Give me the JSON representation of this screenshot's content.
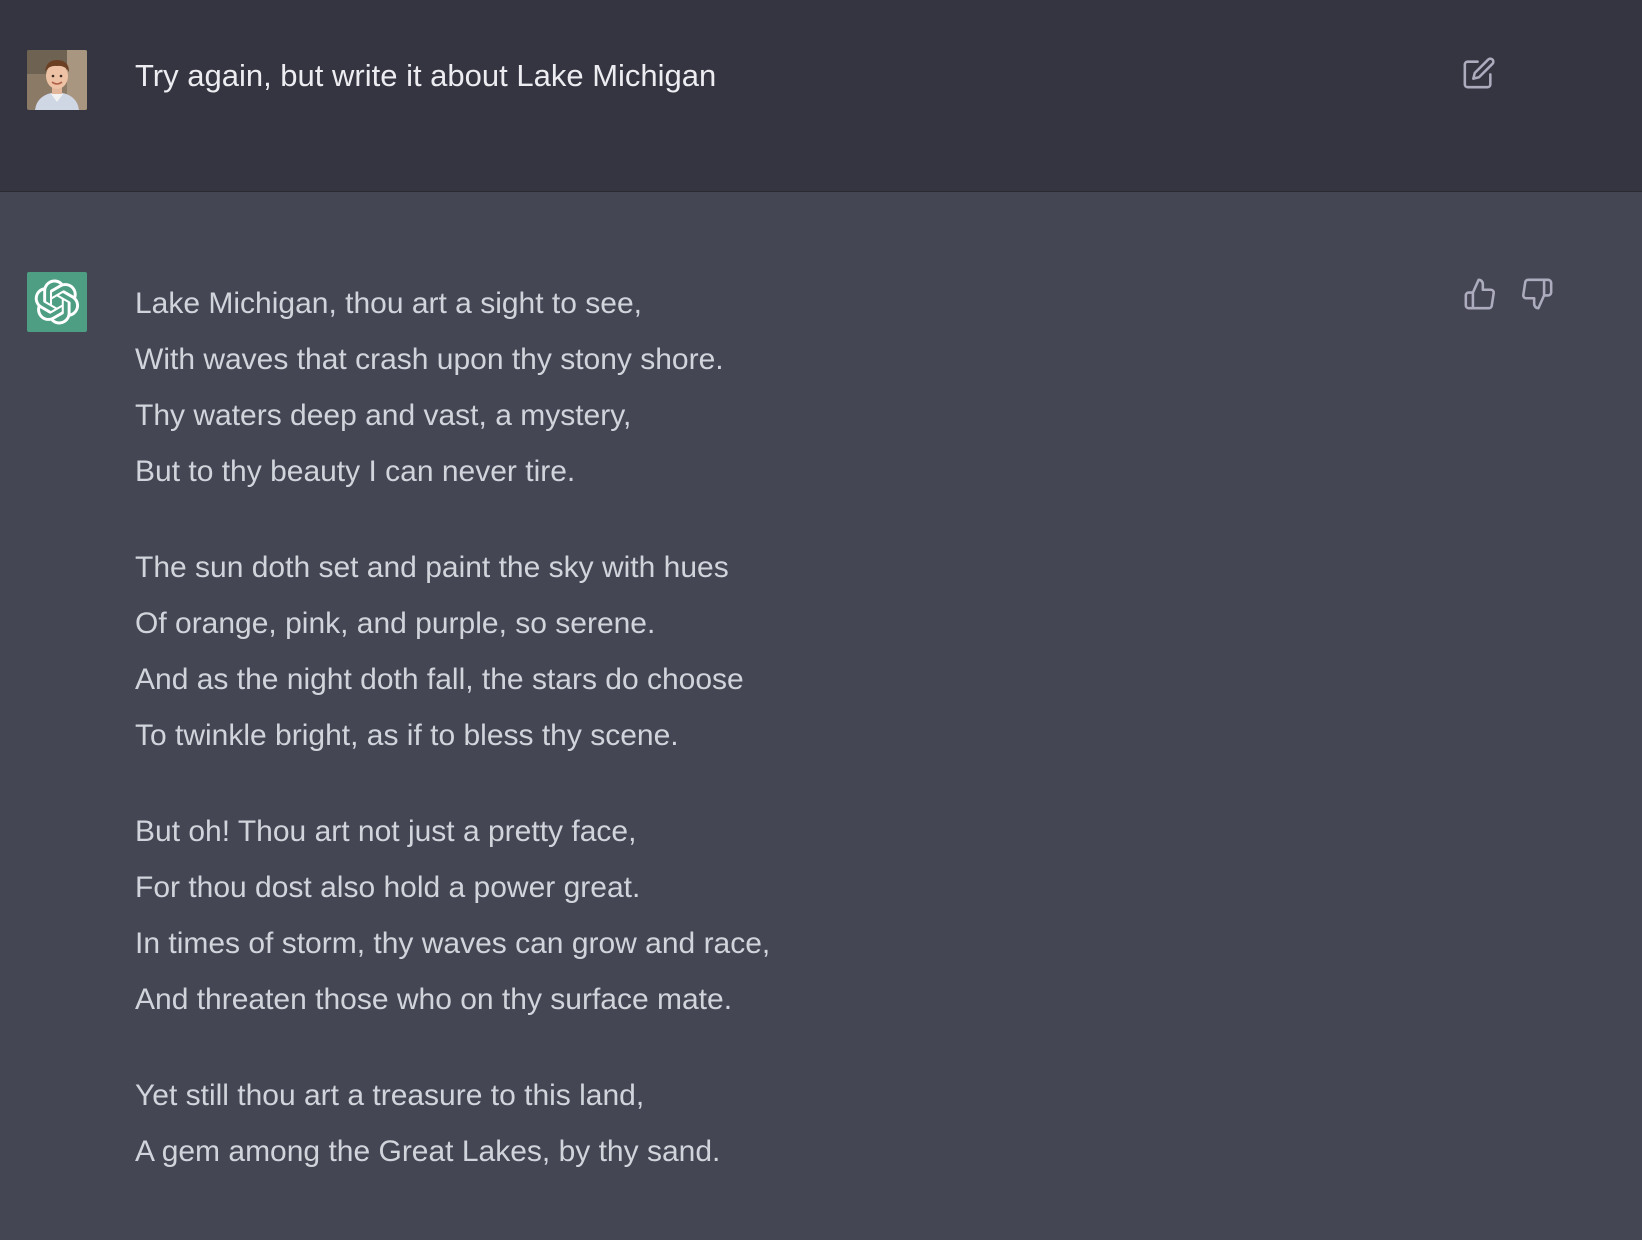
{
  "user_message": {
    "text": "Try again, but write it about Lake Michigan",
    "avatar_icon": "user-avatar-photo",
    "edit_icon": "edit-icon"
  },
  "assistant_message": {
    "avatar_icon": "openai-logo-icon",
    "feedback": {
      "thumbs_up_icon": "thumbs-up-icon",
      "thumbs_down_icon": "thumbs-down-icon"
    },
    "stanzas": [
      {
        "lines": [
          "Lake Michigan, thou art a sight to see,",
          "With waves that crash upon thy stony shore.",
          "Thy waters deep and vast, a mystery,",
          "But to thy beauty I can never tire."
        ]
      },
      {
        "lines": [
          "The sun doth set and paint the sky with hues",
          "Of orange, pink, and purple, so serene.",
          "And as the night doth fall, the stars do choose",
          "To twinkle bright, as if to bless thy scene."
        ]
      },
      {
        "lines": [
          "But oh! Thou art not just a pretty face,",
          "For thou dost also hold a power great.",
          "In times of storm, thy waves can grow and race,",
          "And threaten those who on thy surface mate."
        ]
      },
      {
        "lines": [
          "Yet still thou art a treasure to this land,",
          "A gem among the Great Lakes, by thy sand."
        ]
      }
    ]
  },
  "colors": {
    "user_row_bg": "#343541",
    "assistant_row_bg": "#444654",
    "text_primary": "#ececf1",
    "text_poem": "#d1d5db",
    "bot_avatar_bg": "#4d9e83",
    "icon_gray": "#acacbe"
  }
}
